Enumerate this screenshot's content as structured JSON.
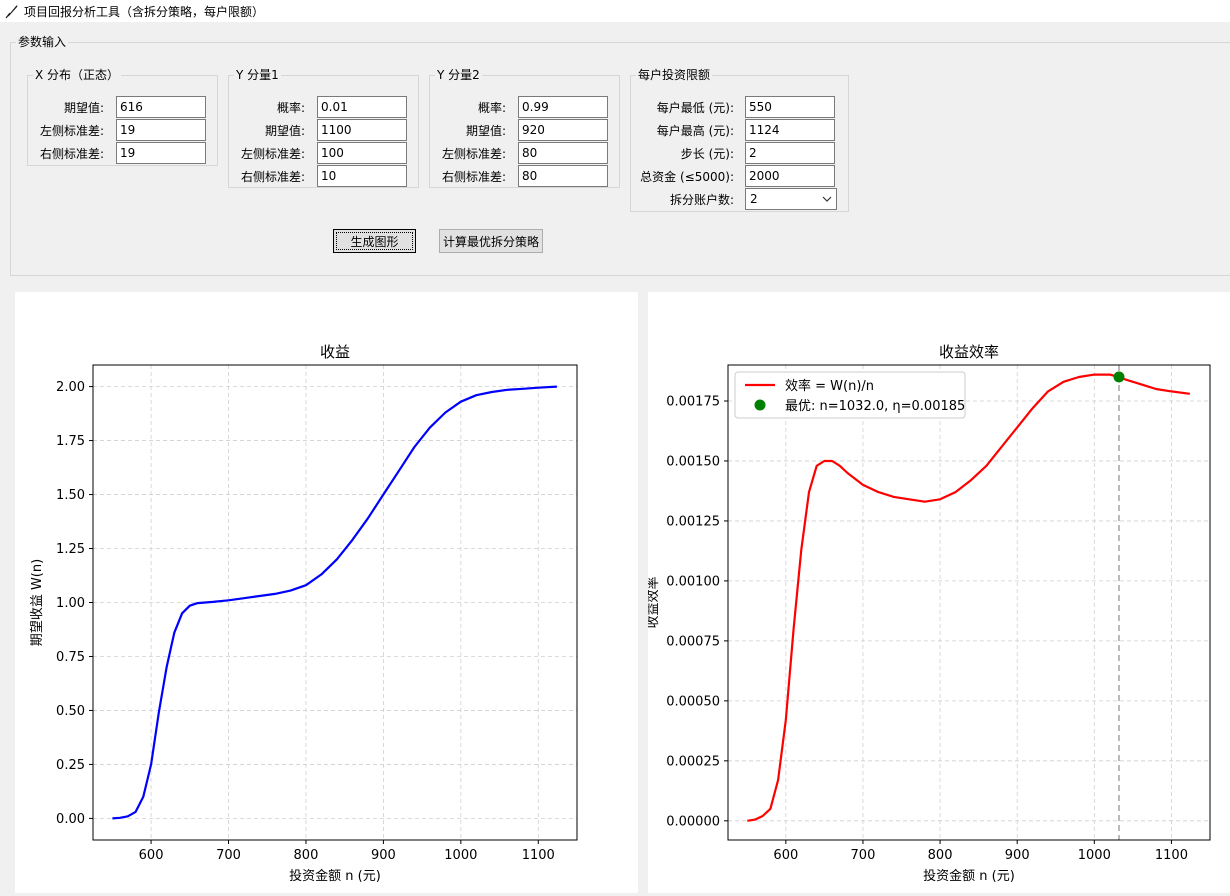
{
  "window": {
    "title": "项目回报分析工具（含拆分策略，每户限额）",
    "icon": "feather-icon"
  },
  "params": {
    "legend": "参数输入",
    "x_dist": {
      "legend": "X 分布（正态）",
      "fields": [
        {
          "label": "期望值:",
          "value": "616"
        },
        {
          "label": "左侧标准差:",
          "value": "19"
        },
        {
          "label": "右侧标准差:",
          "value": "19"
        }
      ]
    },
    "y1": {
      "legend": "Y 分量1",
      "fields": [
        {
          "label": "概率:",
          "value": "0.01"
        },
        {
          "label": "期望值:",
          "value": "1100"
        },
        {
          "label": "左侧标准差:",
          "value": "100"
        },
        {
          "label": "右侧标准差:",
          "value": "10"
        }
      ]
    },
    "y2": {
      "legend": "Y 分量2",
      "fields": [
        {
          "label": "概率:",
          "value": "0.99"
        },
        {
          "label": "期望值:",
          "value": "920"
        },
        {
          "label": "左侧标准差:",
          "value": "80"
        },
        {
          "label": "右侧标准差:",
          "value": "80"
        }
      ]
    },
    "limits": {
      "legend": "每户投资限额",
      "fields": [
        {
          "label": "每户最低 (元):",
          "value": "550"
        },
        {
          "label": "每户最高 (元):",
          "value": "1124"
        },
        {
          "label": "步长 (元):",
          "value": "2"
        },
        {
          "label": "总资金 (≤5000):",
          "value": "2000"
        }
      ],
      "split": {
        "label": "拆分账户数:",
        "value": "2"
      }
    }
  },
  "buttons": {
    "generate": "生成图形",
    "optimize": "计算最优拆分策略"
  },
  "chart_data": [
    {
      "type": "line",
      "title": "收益",
      "xlabel": "投资金额 n (元)",
      "ylabel": "期望收益 W(n)",
      "xlim": [
        525,
        1150
      ],
      "ylim": [
        -0.1,
        2.1
      ],
      "xticks": [
        600,
        700,
        800,
        900,
        1000,
        1100
      ],
      "yticks": [
        0.0,
        0.25,
        0.5,
        0.75,
        1.0,
        1.25,
        1.5,
        1.75,
        2.0
      ],
      "ytick_labels": [
        "0.00",
        "0.25",
        "0.50",
        "0.75",
        "1.00",
        "1.25",
        "1.50",
        "1.75",
        "2.00"
      ],
      "grid": true,
      "series": [
        {
          "color": "#0000ff",
          "x": [
            550,
            560,
            570,
            580,
            590,
            600,
            610,
            620,
            630,
            640,
            650,
            660,
            670,
            680,
            700,
            720,
            740,
            760,
            780,
            800,
            820,
            840,
            860,
            880,
            900,
            920,
            940,
            960,
            980,
            1000,
            1020,
            1040,
            1060,
            1080,
            1100,
            1124
          ],
          "y": [
            0.0,
            0.003,
            0.01,
            0.03,
            0.1,
            0.25,
            0.49,
            0.7,
            0.86,
            0.95,
            0.985,
            0.997,
            1.0,
            1.003,
            1.01,
            1.02,
            1.03,
            1.04,
            1.055,
            1.08,
            1.13,
            1.2,
            1.29,
            1.39,
            1.5,
            1.61,
            1.72,
            1.81,
            1.88,
            1.93,
            1.96,
            1.975,
            1.985,
            1.99,
            1.995,
            2.0
          ]
        }
      ]
    },
    {
      "type": "line",
      "title": "收益效率",
      "xlabel": "投资金额 n (元)",
      "ylabel": "收益效率",
      "xlim": [
        525,
        1150
      ],
      "ylim": [
        -8e-05,
        0.0019
      ],
      "xticks": [
        600,
        700,
        800,
        900,
        1000,
        1100
      ],
      "yticks": [
        0.0,
        0.00025,
        0.0005,
        0.00075,
        0.001,
        0.00125,
        0.0015,
        0.00175
      ],
      "ytick_labels": [
        "0.00000",
        "0.00025",
        "0.00050",
        "0.00075",
        "0.00100",
        "0.00125",
        "0.00150",
        "0.00175"
      ],
      "grid": true,
      "legend_position": "upper left",
      "series": [
        {
          "name": "效率 = W(n)/n",
          "color": "#ff0000",
          "x": [
            550,
            560,
            570,
            580,
            590,
            600,
            610,
            620,
            630,
            640,
            650,
            660,
            670,
            680,
            700,
            720,
            740,
            760,
            780,
            800,
            820,
            840,
            860,
            880,
            900,
            920,
            940,
            960,
            980,
            1000,
            1020,
            1032,
            1040,
            1060,
            1080,
            1100,
            1124
          ],
          "y": [
            0.0,
            5e-06,
            2e-05,
            5e-05,
            0.00017,
            0.00042,
            0.0008,
            0.00113,
            0.00137,
            0.00148,
            0.0015,
            0.0015,
            0.00148,
            0.00145,
            0.0014,
            0.00137,
            0.00135,
            0.00134,
            0.00133,
            0.00134,
            0.00137,
            0.00142,
            0.00148,
            0.00156,
            0.00164,
            0.00172,
            0.00179,
            0.00183,
            0.00185,
            0.00186,
            0.00186,
            0.00185,
            0.00184,
            0.00182,
            0.0018,
            0.00179,
            0.00178
          ]
        }
      ],
      "optimum": {
        "label": "最优: n=1032.0, η=0.00185",
        "x": 1032,
        "y": 0.00185,
        "color": "#008000",
        "vline_color": "#aaaaaa"
      }
    }
  ]
}
